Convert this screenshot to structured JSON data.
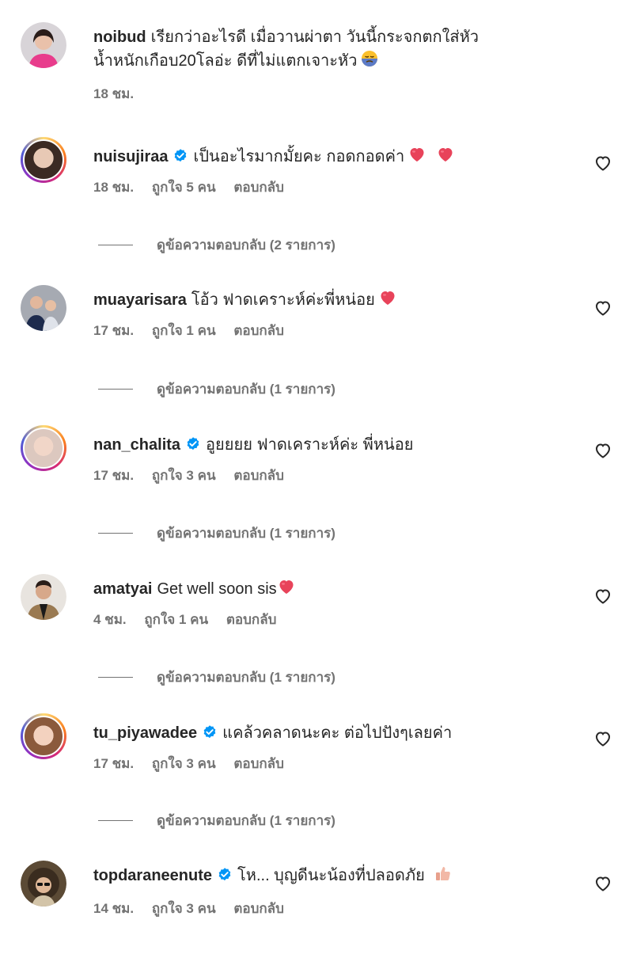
{
  "comments": [
    {
      "username": "noibud",
      "verified": false,
      "text": "เรียกว่าอะไรดี เมื่อวานผ่าตา วันนี้กระจกตกใส่หัว",
      "text2": "น้ำหนักเกือบ20โลอ่ะ ดีที่ไม่แตกเจาะหัว",
      "time": "18 ชม.",
      "likes": "",
      "reply_label": "",
      "replies": ""
    },
    {
      "username": "nuisujiraa",
      "verified": true,
      "text": "เป็นอะไรมากมั้ยคะ กอดกอดค่า",
      "time": "18 ชม.",
      "likes": "ถูกใจ 5 คน",
      "reply_label": "ตอบกลับ",
      "replies": "ดูข้อความตอบกลับ (2 รายการ)"
    },
    {
      "username": "muayarisara",
      "verified": false,
      "text": "โอ้ว ฟาดเคราะห์ค่ะพี่หน่อย",
      "time": "17 ชม.",
      "likes": "ถูกใจ 1 คน",
      "reply_label": "ตอบกลับ",
      "replies": "ดูข้อความตอบกลับ (1 รายการ)"
    },
    {
      "username": "nan_chalita",
      "verified": true,
      "text": "อูยยยย ฟาดเคราะห์ค่ะ พี่หน่อย",
      "time": "17 ชม.",
      "likes": "ถูกใจ 3 คน",
      "reply_label": "ตอบกลับ",
      "replies": "ดูข้อความตอบกลับ (1 รายการ)"
    },
    {
      "username": "amatyai",
      "verified": false,
      "text": "Get well soon sis",
      "time": "4 ชม.",
      "likes": "ถูกใจ 1 คน",
      "reply_label": "ตอบกลับ",
      "replies": "ดูข้อความตอบกลับ (1 รายการ)"
    },
    {
      "username": "tu_piyawadee",
      "verified": true,
      "text": "แคล้วคลาดนะคะ ต่อไปปังๆเลยค่า",
      "time": "17 ชม.",
      "likes": "ถูกใจ 3 คน",
      "reply_label": "ตอบกลับ",
      "replies": "ดูข้อความตอบกลับ (1 รายการ)"
    },
    {
      "username": "topdaraneenute",
      "verified": true,
      "text": "โห... บุญดีนะน้องที่ปลอดภัย",
      "time": "14 ชม.",
      "likes": "ถูกใจ 3 คน",
      "reply_label": "ตอบกลับ",
      "replies": ""
    }
  ],
  "icons": {
    "heart_emoji": "heart-icon",
    "like_button": "heart-outline-icon",
    "verified": "verified-badge-icon",
    "sad_emoji": "disappointed-face-icon",
    "thumbs_up": "thumbs-up-icon"
  },
  "colors": {
    "verified_blue": "#0095f6",
    "emoji_heart": "#e8435a",
    "meta_text": "#737373",
    "ring_gradient": [
      "#feda75",
      "#fa7e1e",
      "#d62976",
      "#962fbf",
      "#4f5bd5"
    ]
  }
}
